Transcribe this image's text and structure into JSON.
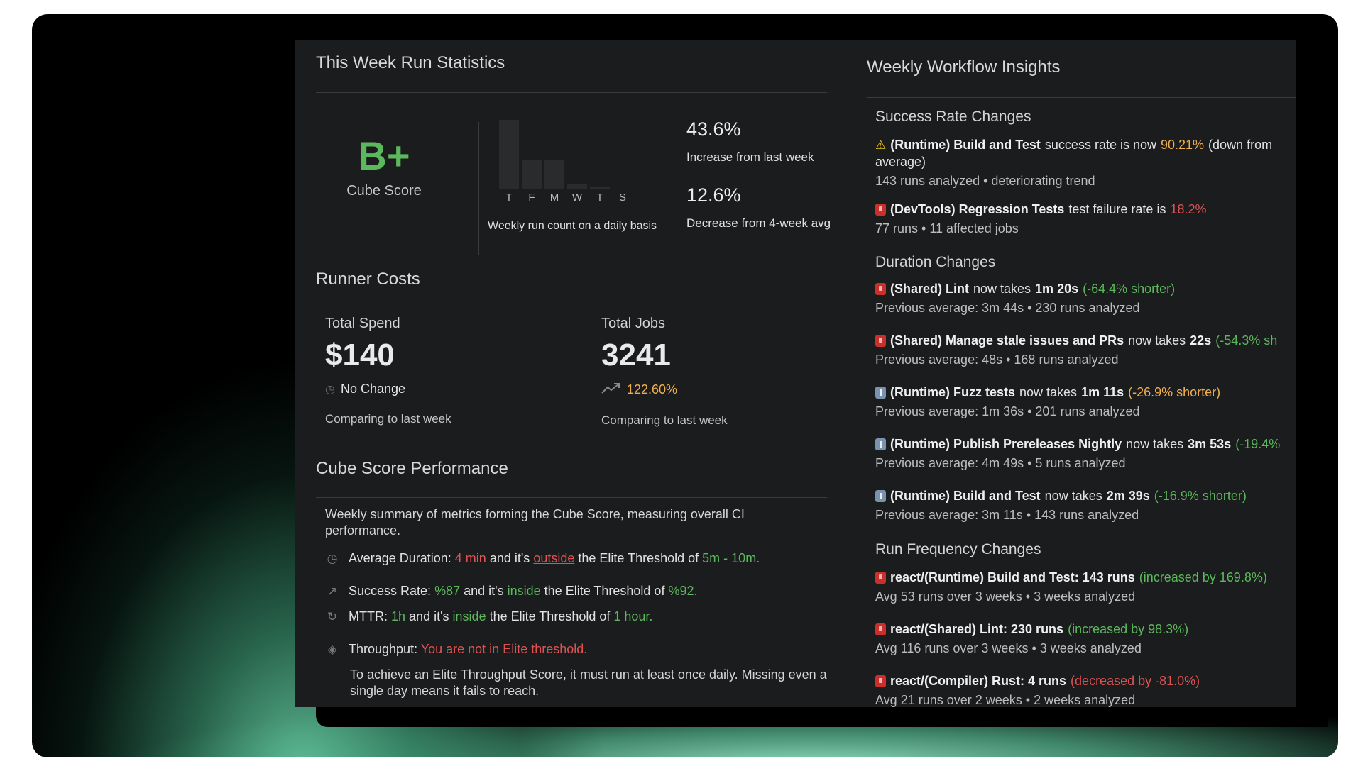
{
  "run_stats": {
    "title": "This Week Run Statistics",
    "grade": "B+",
    "grade_label": "Cube Score",
    "bar_days": [
      "T",
      "F",
      "M",
      "W",
      "T",
      "S"
    ],
    "bars_caption": "Weekly run count on a daily basis",
    "stat1_value": "43.6%",
    "stat1_desc": "Increase from last week",
    "stat2_value": "12.6%",
    "stat2_desc": "Decrease from 4-week avg"
  },
  "runner_costs": {
    "title": "Runner Costs",
    "spend_label": "Total Spend",
    "spend_value": "$140",
    "spend_change": "No Change",
    "spend_compare": "Comparing to last week",
    "jobs_label": "Total Jobs",
    "jobs_value": "3241",
    "jobs_change": "122.60%",
    "jobs_compare": "Comparing to last week"
  },
  "performance": {
    "title": "Cube Score Performance",
    "summary": "Weekly summary of metrics forming the Cube Score, measuring overall CI performance.",
    "duration": {
      "label": "Average Duration:",
      "value": "4 min",
      "mid": "and it's",
      "state": "outside",
      "tail": "the Elite Threshold of",
      "threshold": "5m - 10m."
    },
    "success": {
      "label": "Success Rate:",
      "value": "%87",
      "mid": "and it's",
      "state": "inside",
      "tail": "the Elite Threshold of",
      "threshold": "%92."
    },
    "mttr": {
      "label": "MTTR:",
      "value": "1h",
      "mid": "and it's",
      "state": "inside",
      "tail": "the Elite Threshold of",
      "threshold": "1 hour."
    },
    "throughput": {
      "label": "Throughput:",
      "value": "You are not in Elite threshold."
    },
    "note": "To achieve an Elite Throughput Score, it must run at least once daily. Missing even a single day means it fails to reach."
  },
  "insights": {
    "title": "Weekly Workflow Insights",
    "success_title": "Success Rate Changes",
    "s1": {
      "name": "(Runtime) Build and Test",
      "mid": "success rate is now",
      "value": "90.21%",
      "tail": "(down from",
      "cont": "average)",
      "meta": "143 runs analyzed • deteriorating trend"
    },
    "s2": {
      "name": "(DevTools) Regression Tests",
      "mid": "test failure rate is",
      "value": "18.2%",
      "meta": "77 runs • 11 affected jobs"
    },
    "duration_title": "Duration Changes",
    "d1": {
      "name": "(Shared) Lint",
      "mid": "now takes",
      "time": "1m 20s",
      "delta": "(-64.4% shorter)",
      "meta": "Previous average: 3m 44s • 230 runs analyzed"
    },
    "d2": {
      "name": "(Shared) Manage stale issues and PRs",
      "mid": "now takes",
      "time": "22s",
      "delta": "(-54.3% sh",
      "meta": "Previous average: 48s • 168 runs analyzed"
    },
    "d3": {
      "name": "(Runtime) Fuzz tests",
      "mid": "now takes",
      "time": "1m 11s",
      "delta": "(-26.9% shorter)",
      "meta": "Previous average: 1m 36s • 201 runs analyzed"
    },
    "d4": {
      "name": "(Runtime) Publish Prereleases Nightly",
      "mid": "now takes",
      "time": "3m 53s",
      "delta": "(-19.4%",
      "meta": "Previous average: 4m 49s • 5 runs analyzed"
    },
    "d5": {
      "name": "(Runtime) Build and Test",
      "mid": "now takes",
      "time": "2m 39s",
      "delta": "(-16.9% shorter)",
      "meta": "Previous average: 3m 11s • 143 runs analyzed"
    },
    "freq_title": "Run Frequency Changes",
    "f1": {
      "name": "react/(Runtime) Build and Test: 143 runs",
      "delta": "(increased by 169.8%)",
      "meta": "Avg 53 runs over 3 weeks • 3 weeks analyzed"
    },
    "f2": {
      "name": "react/(Shared) Lint: 230 runs",
      "delta": "(increased by 98.3%)",
      "meta": "Avg 116 runs over 3 weeks • 3 weeks analyzed"
    },
    "f3": {
      "name": "react/(Compiler) Rust: 4 runs",
      "delta": "(decreased by -81.0%)",
      "meta": "Avg 21 runs over 2 weeks • 2 weeks analyzed"
    }
  },
  "colors": {
    "good": "#5cb85c",
    "bad": "#e05252",
    "warn": "#f0ad4e",
    "panel": "#1b1c1d"
  }
}
